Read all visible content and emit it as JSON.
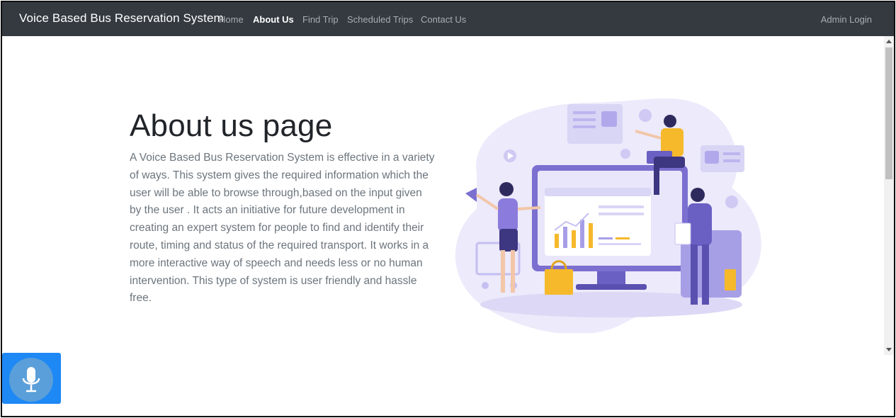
{
  "navbar": {
    "brand": "Voice Based Bus Reservation System",
    "links": [
      {
        "label": "Home",
        "active": false
      },
      {
        "label": "About Us",
        "active": true
      },
      {
        "label": "Find Trip",
        "active": false
      },
      {
        "label": "Scheduled Trips",
        "active": false
      },
      {
        "label": "Contact Us",
        "active": false
      }
    ],
    "admin_login": "Admin Login",
    "background_color": "#343a40"
  },
  "main": {
    "heading": "About us page",
    "paragraph": "A Voice Based Bus Reservation System is effective in a variety of ways. This system gives the required information which the user will be able to browse through,based on the input given by the user . It acts an initiative for future development in creating an expert system for people to find and identify their route, timing and status of the required transport. It works in a more interactive way of speech and needs less or no human intervention. This type of system is user friendly and hassle free."
  },
  "illustration": {
    "icon": "analytics-team-illustration",
    "accent_purple": "#7b6fd0",
    "accent_yellow": "#f5b92b",
    "blob_color": "#eceafb"
  },
  "voice_button": {
    "icon": "microphone-icon",
    "color": "#1e88f5"
  }
}
